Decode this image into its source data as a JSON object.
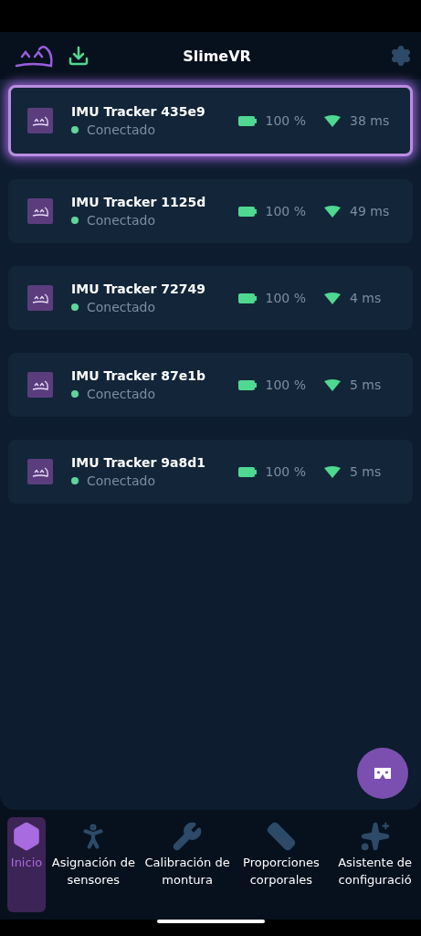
{
  "header": {
    "title": "SlimeVR"
  },
  "trackers": [
    {
      "name": "IMU Tracker 435e9",
      "status": "Conectado",
      "battery": "100 %",
      "ping": "38 ms",
      "selected": true
    },
    {
      "name": "IMU Tracker 1125d",
      "status": "Conectado",
      "battery": "100 %",
      "ping": "49 ms",
      "selected": false
    },
    {
      "name": "IMU Tracker 72749",
      "status": "Conectado",
      "battery": "100 %",
      "ping": "4 ms",
      "selected": false
    },
    {
      "name": "IMU Tracker 87e1b",
      "status": "Conectado",
      "battery": "100 %",
      "ping": "5 ms",
      "selected": false
    },
    {
      "name": "IMU Tracker 9a8d1",
      "status": "Conectado",
      "battery": "100 %",
      "ping": "5 ms",
      "selected": false
    }
  ],
  "nav": [
    {
      "label": "Inicio",
      "selected": true
    },
    {
      "label": "Asignación de sensores",
      "selected": false
    },
    {
      "label": "Calibración de montura",
      "selected": false
    },
    {
      "label": "Proporciones corporales",
      "selected": false
    },
    {
      "label": "Asistente de configuració",
      "selected": false
    }
  ]
}
